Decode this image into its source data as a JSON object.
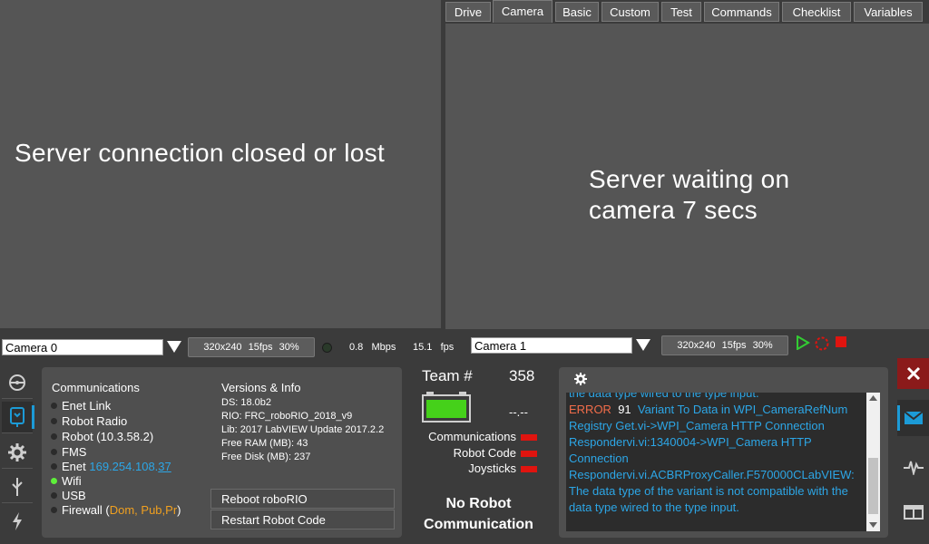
{
  "tabs": [
    "Drive",
    "Camera",
    "Basic",
    "Custom",
    "Test",
    "Commands",
    "Checklist",
    "Variables"
  ],
  "active_tab": "Camera",
  "camera_left": {
    "message": "Server connection closed or lost"
  },
  "camera_right": {
    "message": "Server waiting on camera 7 secs"
  },
  "cam0": {
    "select": "Camera 0",
    "resolution": "320x240",
    "fps_setting": "15fps",
    "compression": "30%",
    "bandwidth_value": "0.8",
    "bandwidth_unit": "Mbps",
    "fps_value": "15.1",
    "fps_unit": "fps"
  },
  "cam1": {
    "select": "Camera 1",
    "resolution": "320x240",
    "fps_setting": "15fps",
    "compression": "30%"
  },
  "communications": {
    "title": "Communications",
    "enet_link": "Enet Link",
    "robot_radio": "Robot Radio",
    "robot": "Robot (10.3.58.2)",
    "fms": "FMS",
    "enet_label": "Enet",
    "enet_ip_main": "169.254.108.",
    "enet_ip_last": "37",
    "wifi": "Wifi",
    "usb": "USB",
    "firewall_label": "Firewall (",
    "firewall_values": "Dom, Pub,Pr",
    "firewall_close": ")"
  },
  "versions": {
    "title": "Versions & Info",
    "ds": "DS:  18.0b2",
    "rio": "RIO:  FRC_roboRIO_2018_v9",
    "lib": "Lib:  2017 LabVIEW Update 2017.2.2",
    "free_ram": "Free RAM (MB): 43",
    "free_disk": "Free Disk (MB): 237"
  },
  "buttons": {
    "reboot": "Reboot roboRIO",
    "restart": "Restart Robot Code"
  },
  "team": {
    "label": "Team #",
    "number": "358",
    "battery_voltage": "--.--",
    "communications": "Communications",
    "robot_code": "Robot Code",
    "joysticks": "Joysticks",
    "status_line1": "No Robot",
    "status_line2": "Communication"
  },
  "messages": {
    "line_top": "the data type wired to the type input.",
    "error_label": "ERROR",
    "error_code": "91",
    "error_text": "Variant To Data in WPI_CameraRefNum Registry Get.vi->WPI_Camera HTTP Connection Respondervi.vi:1340004->WPI_Camera HTTP Connection Respondervi.vi.ACBRProxyCaller.F570000CLabVIEW: The data type of the variant is not compatible with the data type wired to the type input."
  },
  "colors": {
    "accent": "#1c9bd7",
    "status_red": "#e0140f",
    "led_green": "#5ef03a",
    "error_orange": "#f26d4a",
    "firewall_orange": "#f0a020",
    "message_blue": "#2ca6e6"
  }
}
